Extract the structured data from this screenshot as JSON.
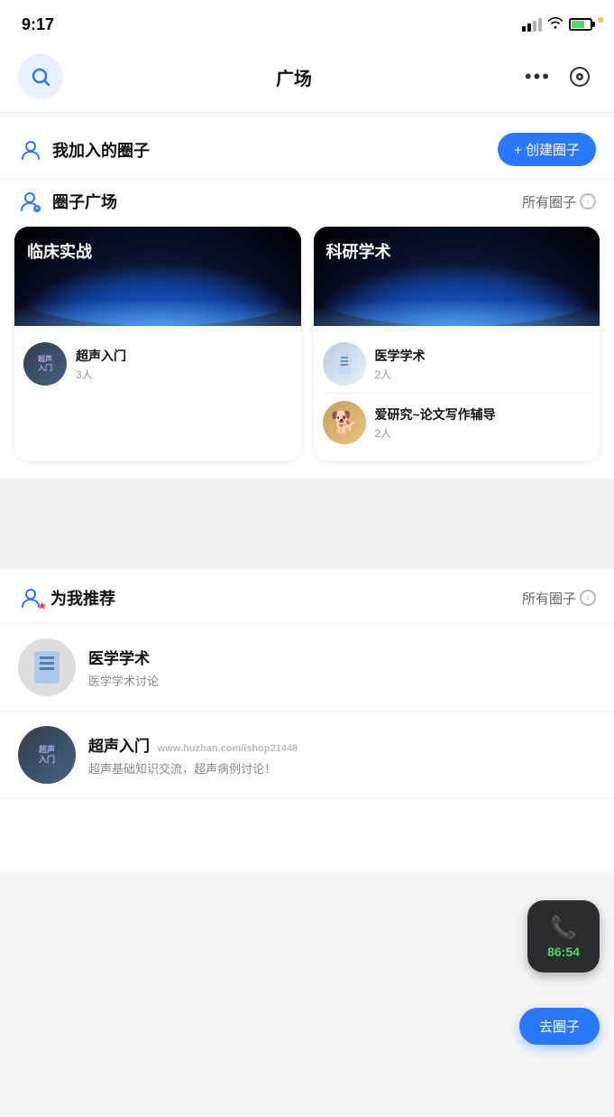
{
  "statusBar": {
    "time": "9:17"
  },
  "header": {
    "title": "广场",
    "moreLabel": "•••"
  },
  "myCircles": {
    "label": "我加入的圈子",
    "createBtn": "+ 创建圈子"
  },
  "circleSquare": {
    "label": "圈子广场",
    "allCirclesLabel": "所有圈子",
    "categories": [
      {
        "title": "临床实战",
        "items": [
          {
            "name": "超声入门",
            "count": "3人"
          }
        ]
      },
      {
        "title": "科研学术",
        "items": [
          {
            "name": "医学学术",
            "count": "2人"
          },
          {
            "name": "爱研究~论文写作辅导",
            "count": "2人"
          }
        ]
      }
    ]
  },
  "recommendations": {
    "label": "为我推荐",
    "allCirclesLabel": "所有圈子",
    "items": [
      {
        "name": "医学学术",
        "desc": "医学学术讨论"
      },
      {
        "name": "超声入门",
        "desc": "超声基础知识交流，超声病例讨论！",
        "watermark": "www.huzhan.com/ishop21448"
      }
    ]
  },
  "floatingCall": {
    "time": "86:54"
  },
  "joinBtn": "去圈子"
}
